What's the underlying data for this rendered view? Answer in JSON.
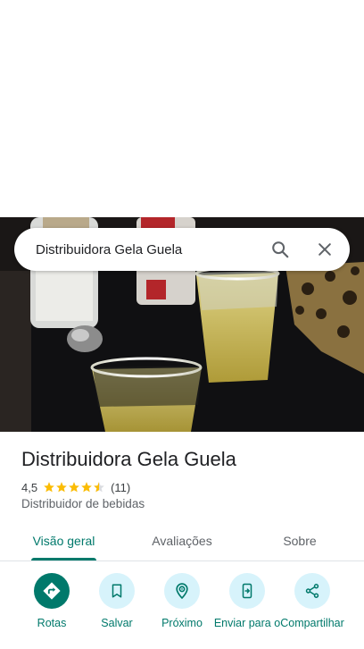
{
  "search": {
    "query": "Distribuidora Gela Guela"
  },
  "place": {
    "name": "Distribuidora Gela Guela",
    "rating": "4,5",
    "stars": 4.5,
    "review_count": "(11)",
    "category": "Distribuidor de bebidas"
  },
  "tabs": [
    {
      "label": "Visão geral",
      "active": true
    },
    {
      "label": "Avaliações",
      "active": false
    },
    {
      "label": "Sobre",
      "active": false
    }
  ],
  "actions": [
    {
      "label": "Rotas",
      "icon": "directions-icon"
    },
    {
      "label": "Salvar",
      "icon": "bookmark-icon"
    },
    {
      "label": "Próximo",
      "icon": "nearby-icon"
    },
    {
      "label": "Enviar para o",
      "icon": "send-to-phone-icon"
    },
    {
      "label": "Compartilhar",
      "icon": "share-icon"
    }
  ],
  "colors": {
    "accent": "#00796b",
    "action_bg": "#d7f3fb",
    "star": "#fbbc04",
    "title_text": "#202124",
    "secondary_text": "#5f6368"
  }
}
